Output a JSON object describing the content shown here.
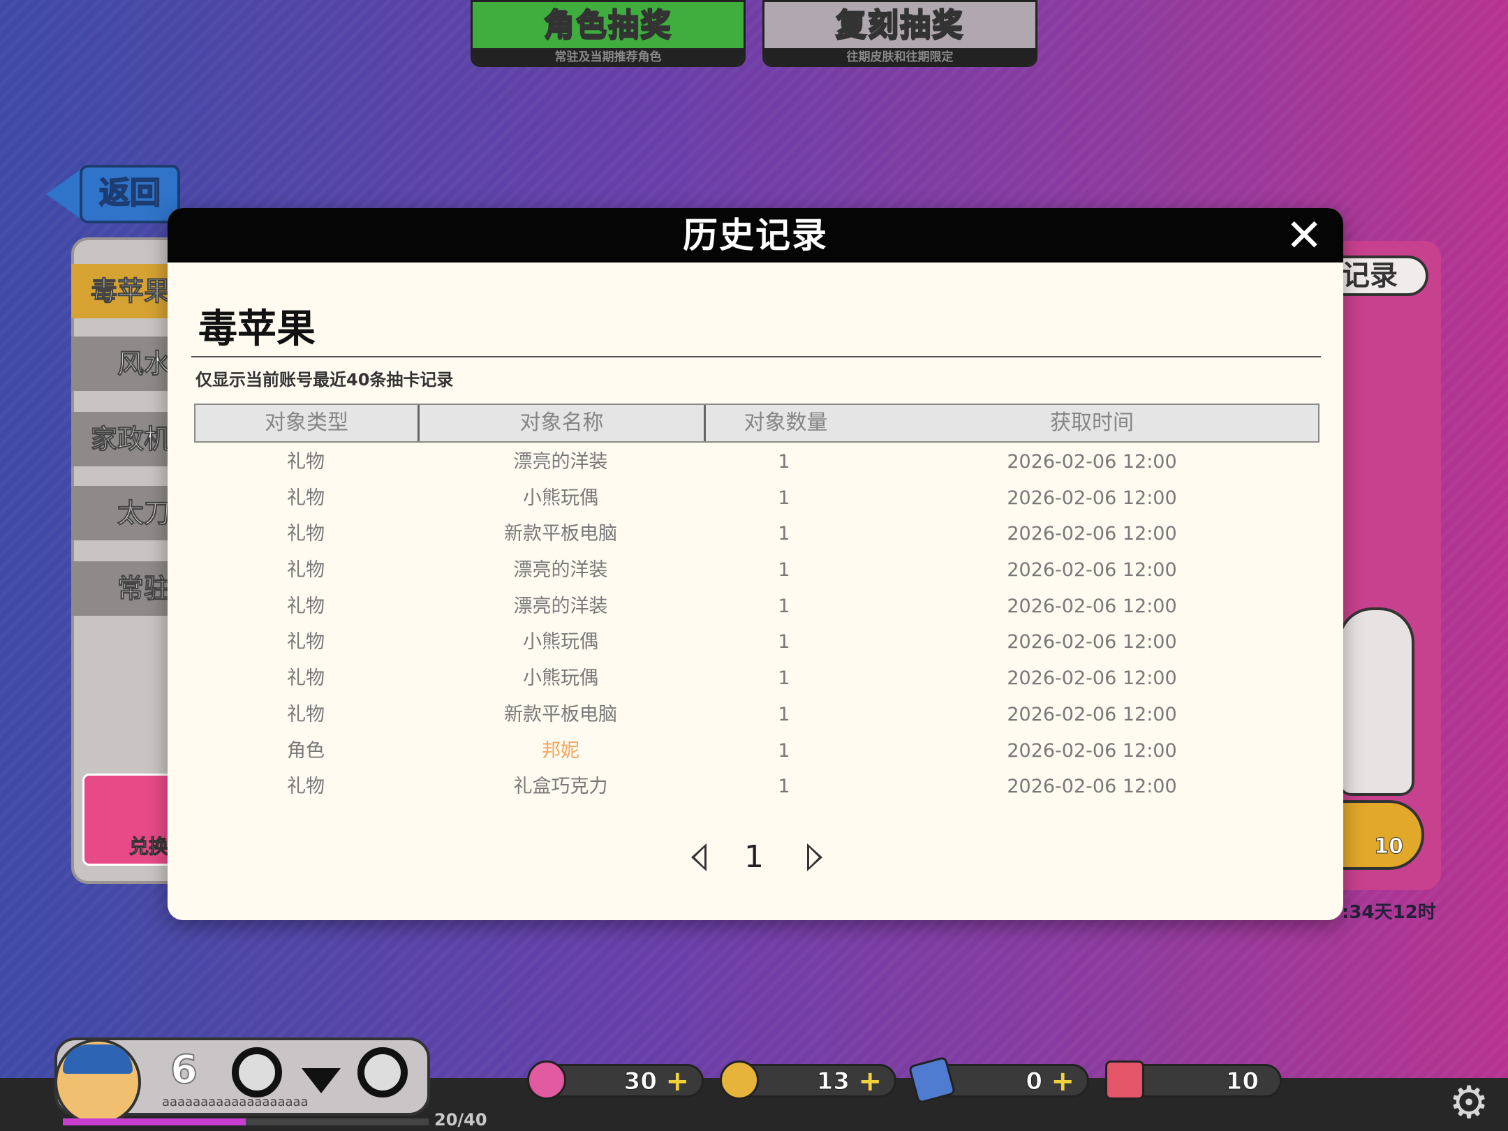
{
  "top_tabs": [
    {
      "label": "角色抽奖",
      "sub": "常驻及当期推荐角色"
    },
    {
      "label": "复刻抽奖",
      "sub": "往期皮肤和往期限定"
    }
  ],
  "back_button": "返回",
  "left_menu": [
    "毒苹果",
    "风水",
    "家政机",
    "太刀",
    "常驻"
  ],
  "left_exchange_label": "兑换",
  "right_panel": {
    "record_label": "记录",
    "ticket_count": "10",
    "timer": ":34天12时"
  },
  "modal": {
    "title": "历史记录",
    "close_icon": "close-icon",
    "pool_name": "毒苹果",
    "notice": "仅显示当前账号最近40条抽卡记录",
    "columns": [
      "对象类型",
      "对象名称",
      "对象数量",
      "获取时间"
    ],
    "rows": [
      {
        "type": "礼物",
        "name": "漂亮的洋装",
        "qty": "1",
        "time": "2026-02-06 12:00",
        "highlight": false
      },
      {
        "type": "礼物",
        "name": "小熊玩偶",
        "qty": "1",
        "time": "2026-02-06 12:00",
        "highlight": false
      },
      {
        "type": "礼物",
        "name": "新款平板电脑",
        "qty": "1",
        "time": "2026-02-06 12:00",
        "highlight": false
      },
      {
        "type": "礼物",
        "name": "漂亮的洋装",
        "qty": "1",
        "time": "2026-02-06 12:00",
        "highlight": false
      },
      {
        "type": "礼物",
        "name": "漂亮的洋装",
        "qty": "1",
        "time": "2026-02-06 12:00",
        "highlight": false
      },
      {
        "type": "礼物",
        "name": "小熊玩偶",
        "qty": "1",
        "time": "2026-02-06 12:00",
        "highlight": false
      },
      {
        "type": "礼物",
        "name": "小熊玩偶",
        "qty": "1",
        "time": "2026-02-06 12:00",
        "highlight": false
      },
      {
        "type": "礼物",
        "name": "新款平板电脑",
        "qty": "1",
        "time": "2026-02-06 12:00",
        "highlight": false
      },
      {
        "type": "角色",
        "name": "邦妮",
        "qty": "1",
        "time": "2026-02-06 12:00",
        "highlight": true
      },
      {
        "type": "礼物",
        "name": "礼盒巧克力",
        "qty": "1",
        "time": "2026-02-06 12:00",
        "highlight": false
      }
    ],
    "page": "1",
    "highlight_color": "#f5a45c"
  },
  "player": {
    "level": "6",
    "name": "aaaaaaaaaaaaaaaaaaa",
    "xp_text": "20/40",
    "xp_fraction": 0.5
  },
  "resources": [
    {
      "icon": "gem-disc-icon",
      "value": "30",
      "plus": "+"
    },
    {
      "icon": "gold-disc-icon",
      "value": "13",
      "plus": "+"
    },
    {
      "icon": "card-ticket-icon",
      "value": "0",
      "plus": "+"
    },
    {
      "icon": "gift-pack-icon",
      "value": "10",
      "plus": ""
    }
  ],
  "colors": {
    "tab_active": "#3fae3f",
    "tab_inactive": "#b0a8ae",
    "back_button": "#2f74c9",
    "xp_bar": "#c93fd3"
  }
}
